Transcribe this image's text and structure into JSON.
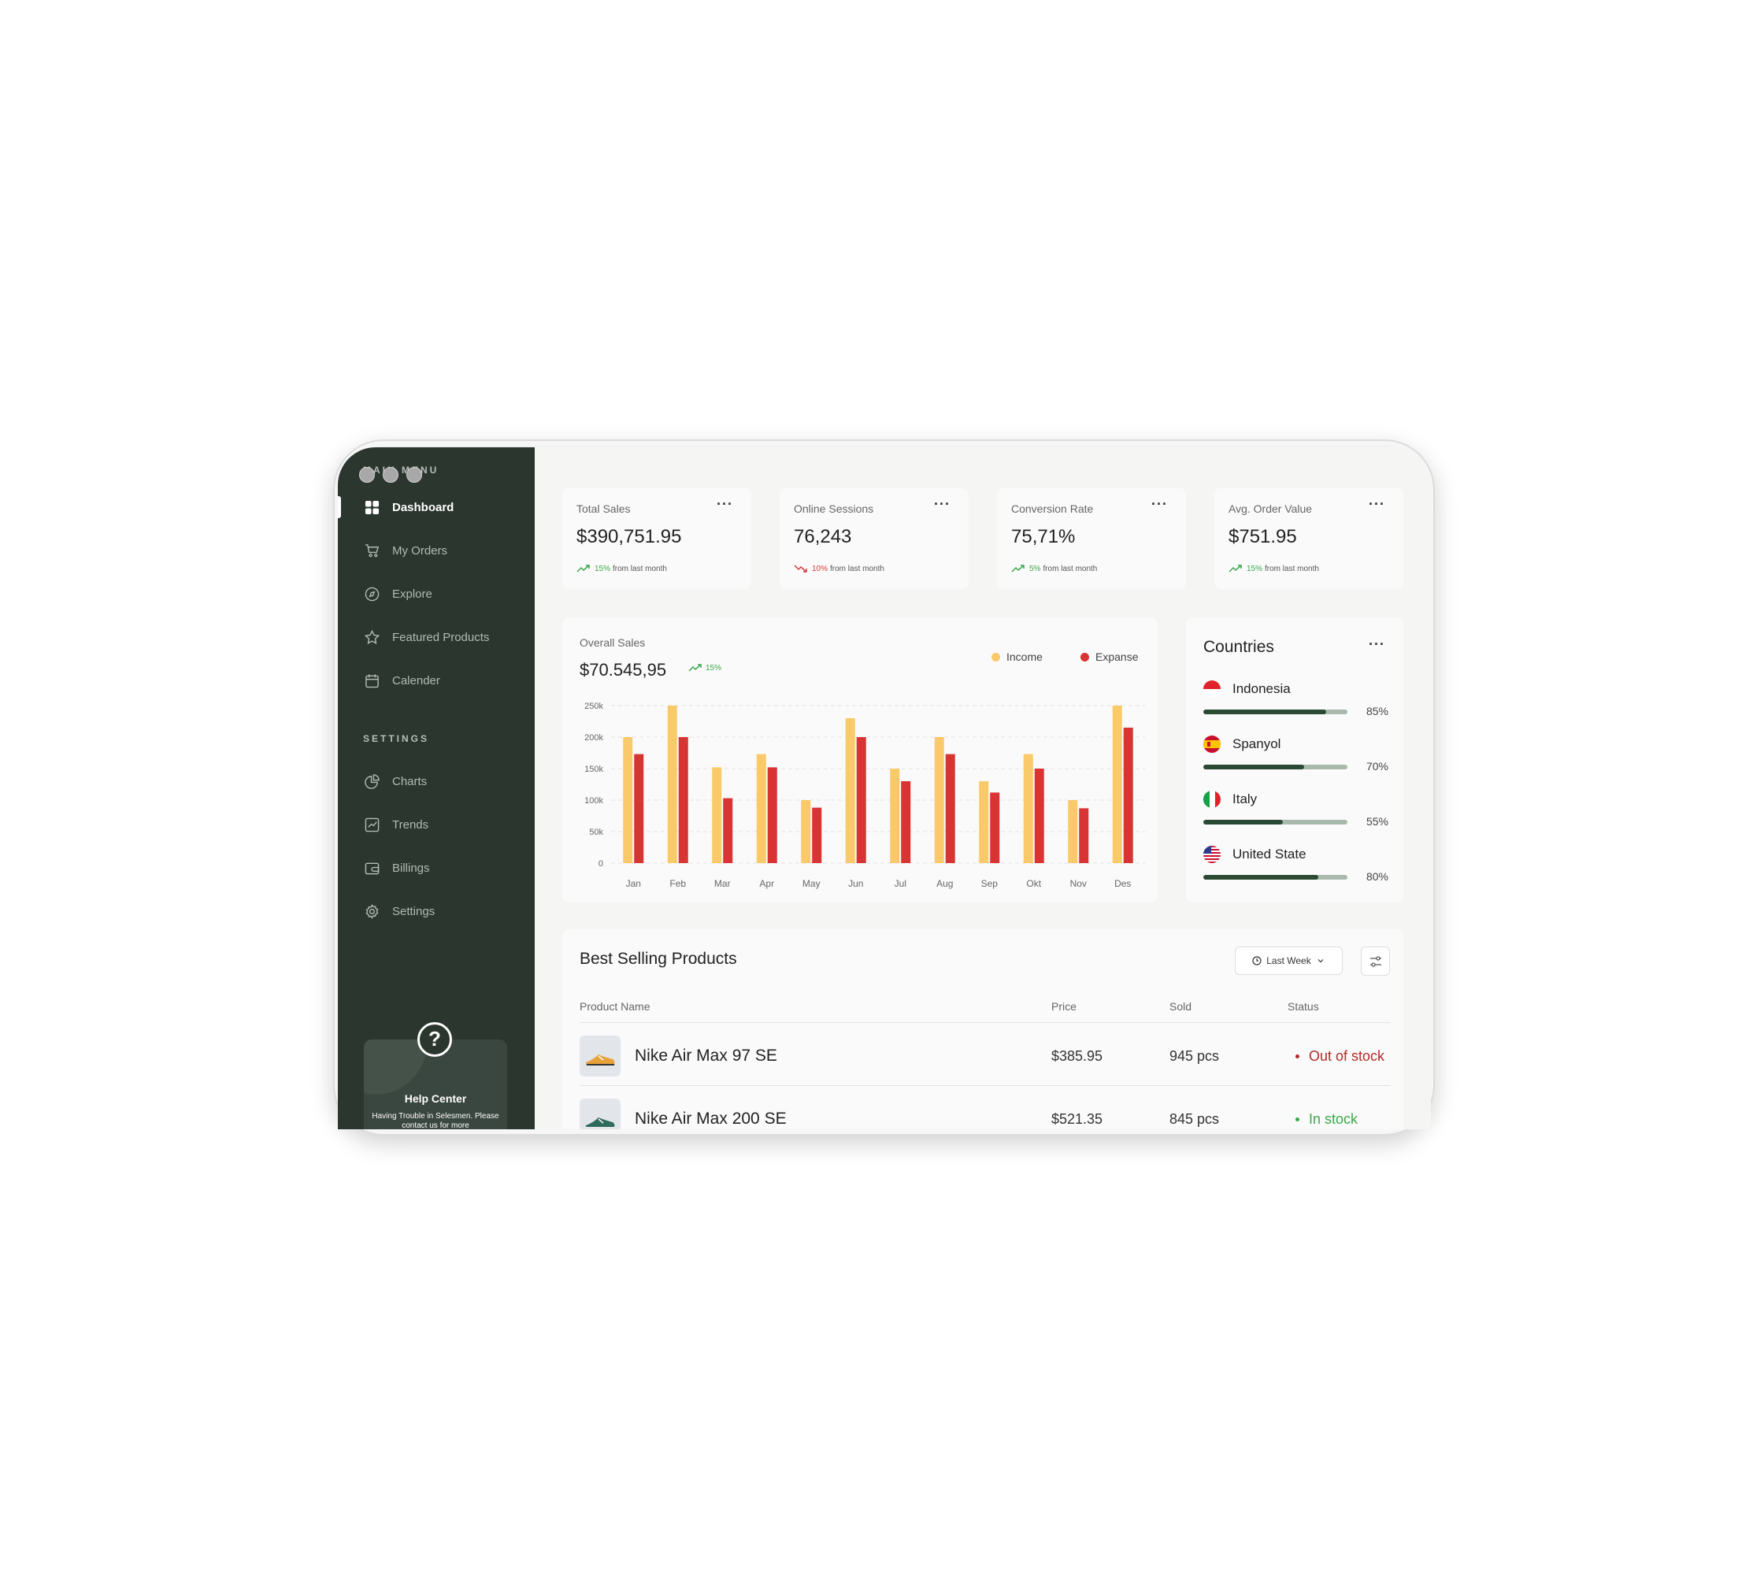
{
  "sidebar": {
    "main_menu_label": "MAIN MENU",
    "settings_label": "SETTINGS",
    "main_items": [
      {
        "label": "Dashboard",
        "icon": "grid-icon",
        "active": true
      },
      {
        "label": "My Orders",
        "icon": "cart-icon"
      },
      {
        "label": "Explore",
        "icon": "compass-icon"
      },
      {
        "label": "Featured Products",
        "icon": "star-icon"
      },
      {
        "label": "Calender",
        "icon": "calendar-icon"
      }
    ],
    "settings_items": [
      {
        "label": "Charts",
        "icon": "pie-chart-icon"
      },
      {
        "label": "Trends",
        "icon": "trend-chart-icon"
      },
      {
        "label": "Billings",
        "icon": "wallet-icon"
      },
      {
        "label": "Settings",
        "icon": "gear-icon"
      }
    ],
    "help": {
      "title": "Help Center",
      "text": "Having Trouble in Selesmen. Please contact us for more"
    }
  },
  "stats": [
    {
      "title": "Total Sales",
      "value": "$390,751.95",
      "change": "15%",
      "direction": "up",
      "suffix": "from last month"
    },
    {
      "title": "Online Sessions",
      "value": "76,243",
      "change": "10%",
      "direction": "down",
      "suffix": "from last month"
    },
    {
      "title": "Conversion Rate",
      "value": "75,71%",
      "change": "5%",
      "direction": "up",
      "suffix": "from last month"
    },
    {
      "title": "Avg. Order Value",
      "value": "$751.95",
      "change": "15%",
      "direction": "up",
      "suffix": "from last month"
    }
  ],
  "sales": {
    "title": "Overall Sales",
    "value": "$70.545,95",
    "change": "15%"
  },
  "chart_data": {
    "type": "bar",
    "categories": [
      "Jan",
      "Feb",
      "Mar",
      "Apr",
      "May",
      "Jun",
      "Jul",
      "Aug",
      "Sep",
      "Okt",
      "Nov",
      "Des"
    ],
    "series": [
      {
        "name": "Income",
        "color": "#f9c96a",
        "values": [
          200,
          250,
          152,
          173,
          100,
          230,
          150,
          200,
          130,
          173,
          100,
          250
        ]
      },
      {
        "name": "Expanse",
        "color": "#d83434",
        "values": [
          173,
          200,
          103,
          152,
          88,
          200,
          130,
          173,
          112,
          150,
          87,
          215
        ]
      }
    ],
    "yticks": [
      "0",
      "50k",
      "100k",
      "150k",
      "200k",
      "250k"
    ],
    "ylim": [
      0,
      250
    ],
    "grid": true,
    "legend": "top-right"
  },
  "countries": {
    "title": "Countries",
    "items": [
      {
        "name": "Indonesia",
        "value": 85,
        "label": "85%",
        "flag": "indonesia-flag-icon"
      },
      {
        "name": "Spanyol",
        "value": 70,
        "label": "70%",
        "flag": "spain-flag-icon"
      },
      {
        "name": "Italy",
        "value": 55,
        "label": "55%",
        "flag": "italy-flag-icon"
      },
      {
        "name": "United State",
        "value": 80,
        "label": "80%",
        "flag": "usa-flag-icon"
      }
    ]
  },
  "products": {
    "title": "Best Selling Products",
    "filter_label": "Last Week",
    "columns": [
      "Product Name",
      "Price",
      "Sold",
      "Status"
    ],
    "rows": [
      {
        "name": "Nike Air Max 97 SE",
        "price": "$385.95",
        "sold": "945 pcs",
        "status": "Out of stock",
        "status_color": "#b02a2a"
      },
      {
        "name": "Nike Air Max 200 SE",
        "price": "$521.35",
        "sold": "845 pcs",
        "status": "In stock",
        "status_color": "#3aa84a"
      }
    ]
  }
}
